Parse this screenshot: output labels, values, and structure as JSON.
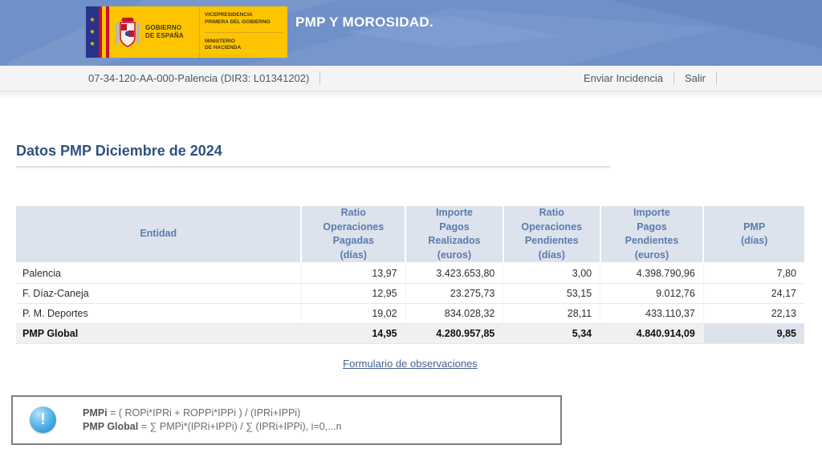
{
  "colors": {
    "header_blue": "#6f90c8",
    "logo_yellow": "#ffc400",
    "eu_band_blue": "#27348b",
    "title_navy": "#30517f",
    "table_header_bg": "#dce3ed",
    "table_header_text": "#5b7bad",
    "total_row_bg": "#f0f0f0",
    "total_pmp_cell_bg": "#dce3ed",
    "link_color": "#44618c",
    "info_icon_blue": "#58b5e8"
  },
  "header": {
    "app_title": "PMP Y MOROSIDAD.",
    "logo": {
      "gobierno": "GOBIERNO\nDE ESPAÑA",
      "department": "VICEPRESIDENCIA\nPRIMERA DEL GOBIERNO",
      "ministry": "MINISTERIO\nDE HACIENDA"
    }
  },
  "toolbar": {
    "entity_code": "07-34-120-AA-000-Palencia (DIR3: L01341202)",
    "links": {
      "enviar_incidencia": "Enviar Incidencia",
      "salir": "Salir"
    }
  },
  "main": {
    "page_title": "Datos PMP Diciembre de 2024",
    "table": {
      "columns": [
        "Entidad",
        "Ratio\nOperaciones\nPagadas\n(días)",
        "Importe\nPagos\nRealizados\n(euros)",
        "Ratio\nOperaciones\nPendientes\n(días)",
        "Importe\nPagos\nPendientes\n(euros)",
        "PMP\n(días)"
      ],
      "rows": [
        {
          "cells": [
            "Palencia",
            "13,97",
            "3.423.653,80",
            "3,00",
            "4.398.790,96",
            "7,80"
          ]
        },
        {
          "cells": [
            "F. Díaz-Caneja",
            "12,95",
            "23.275,73",
            "53,15",
            "9.012,76",
            "24,17"
          ]
        },
        {
          "cells": [
            "P. M. Deportes",
            "19,02",
            "834.028,32",
            "28,11",
            "433.110,37",
            "22,13"
          ]
        }
      ],
      "total_row": {
        "cells": [
          "PMP Global",
          "14,95",
          "4.280.957,85",
          "5,34",
          "4.840.914,09",
          "9,85"
        ]
      }
    },
    "observations_link": "Formulario de observaciones"
  },
  "info_box": {
    "icon_glyph": "!",
    "formulas": [
      {
        "term": "PMPi",
        "definition": " = ( ROPi*IPRi + ROPPi*IPPi ) / (IPRi+IPPi)"
      },
      {
        "term": "PMP Global",
        "definition": " = ∑ PMPi*(IPRi+IPPi) / ∑ (IPRi+IPPi), i=0,...n"
      }
    ]
  }
}
